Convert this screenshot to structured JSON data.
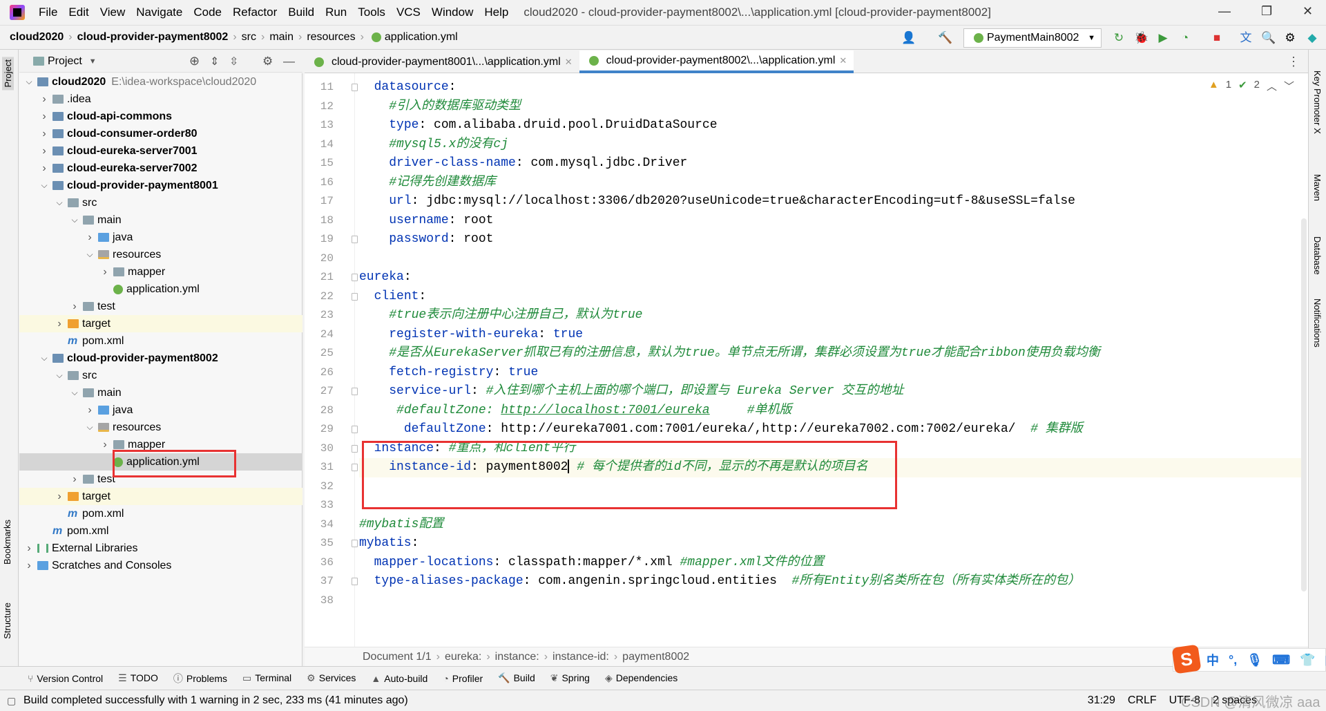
{
  "menubar": {
    "items": [
      "File",
      "Edit",
      "View",
      "Navigate",
      "Code",
      "Refactor",
      "Build",
      "Run",
      "Tools",
      "VCS",
      "Window",
      "Help"
    ],
    "window_title": "cloud2020 - cloud-provider-payment8002\\...\\application.yml [cloud-provider-payment8002]"
  },
  "navbar": {
    "crumbs": [
      "cloud2020",
      "cloud-provider-payment8002",
      "src",
      "main",
      "resources",
      "application.yml"
    ],
    "run_config": "PaymentMain8002"
  },
  "left_strip": {
    "project": "Project",
    "bookmarks": "Bookmarks",
    "structure": "Structure"
  },
  "right_strip": {
    "key_promoter": "Key Promoter X",
    "maven": "Maven",
    "database": "Database",
    "notifications": "Notifications"
  },
  "project_panel": {
    "title": "Project",
    "tree": [
      {
        "label": "cloud2020",
        "extra": "E:\\idea-workspace\\cloud2020",
        "depth": 0,
        "icon": "module",
        "open": true,
        "bold": true
      },
      {
        "label": ".idea",
        "depth": 1,
        "icon": "folder",
        "open": false
      },
      {
        "label": "cloud-api-commons",
        "depth": 1,
        "icon": "module",
        "open": false,
        "bold": true
      },
      {
        "label": "cloud-consumer-order80",
        "depth": 1,
        "icon": "module",
        "open": false,
        "bold": true
      },
      {
        "label": "cloud-eureka-server7001",
        "depth": 1,
        "icon": "module",
        "open": false,
        "bold": true
      },
      {
        "label": "cloud-eureka-server7002",
        "depth": 1,
        "icon": "module",
        "open": false,
        "bold": true
      },
      {
        "label": "cloud-provider-payment8001",
        "depth": 1,
        "icon": "module",
        "open": true,
        "bold": true
      },
      {
        "label": "src",
        "depth": 2,
        "icon": "folder",
        "open": true
      },
      {
        "label": "main",
        "depth": 3,
        "icon": "folder",
        "open": true
      },
      {
        "label": "java",
        "depth": 4,
        "icon": "source",
        "open": false
      },
      {
        "label": "resources",
        "depth": 4,
        "icon": "resources",
        "open": true
      },
      {
        "label": "mapper",
        "depth": 5,
        "icon": "folder",
        "open": false
      },
      {
        "label": "application.yml",
        "depth": 5,
        "icon": "yml",
        "leaf": true
      },
      {
        "label": "test",
        "depth": 3,
        "icon": "folder",
        "open": false
      },
      {
        "label": "target",
        "depth": 2,
        "icon": "target",
        "open": false,
        "highlight": true
      },
      {
        "label": "pom.xml",
        "depth": 2,
        "icon": "pom",
        "leaf": true
      },
      {
        "label": "cloud-provider-payment8002",
        "depth": 1,
        "icon": "module",
        "open": true,
        "bold": true
      },
      {
        "label": "src",
        "depth": 2,
        "icon": "folder",
        "open": true
      },
      {
        "label": "main",
        "depth": 3,
        "icon": "folder",
        "open": true
      },
      {
        "label": "java",
        "depth": 4,
        "icon": "source",
        "open": false
      },
      {
        "label": "resources",
        "depth": 4,
        "icon": "resources",
        "open": true
      },
      {
        "label": "mapper",
        "depth": 5,
        "icon": "folder",
        "open": false
      },
      {
        "label": "application.yml",
        "depth": 5,
        "icon": "yml",
        "leaf": true,
        "selected": true
      },
      {
        "label": "test",
        "depth": 3,
        "icon": "folder",
        "open": false
      },
      {
        "label": "target",
        "depth": 2,
        "icon": "target",
        "open": false,
        "highlight": true
      },
      {
        "label": "pom.xml",
        "depth": 2,
        "icon": "pom",
        "leaf": true
      },
      {
        "label": "pom.xml",
        "depth": 1,
        "icon": "pom",
        "leaf": true
      },
      {
        "label": "External Libraries",
        "depth": 0,
        "icon": "library",
        "open": false
      },
      {
        "label": "Scratches and Consoles",
        "depth": 0,
        "icon": "scratch",
        "open": false
      }
    ]
  },
  "tabs": [
    {
      "label": "cloud-provider-payment8001\\...\\application.yml",
      "active": false
    },
    {
      "label": "cloud-provider-payment8002\\...\\application.yml",
      "active": true
    }
  ],
  "inspections": {
    "warnings": "1",
    "ok": "2"
  },
  "editor": {
    "first_line": 11,
    "current_line": 31,
    "lines": [
      [
        [
          "  ",
          ""
        ],
        [
          "datasource",
          "k"
        ],
        [
          ":",
          "v"
        ]
      ],
      [
        [
          "    ",
          ""
        ],
        [
          "#引入的数据库驱动类型",
          "c"
        ]
      ],
      [
        [
          "    ",
          ""
        ],
        [
          "type",
          "k"
        ],
        [
          ": com.alibaba.druid.pool.DruidDataSource",
          "v"
        ]
      ],
      [
        [
          "    ",
          ""
        ],
        [
          "#mysql5.x的没有cj",
          "c"
        ]
      ],
      [
        [
          "    ",
          ""
        ],
        [
          "driver-class-name",
          "k"
        ],
        [
          ": com.mysql.jdbc.Driver",
          "v"
        ]
      ],
      [
        [
          "    ",
          ""
        ],
        [
          "#记得先创建数据库",
          "c"
        ]
      ],
      [
        [
          "    ",
          ""
        ],
        [
          "url",
          "k"
        ],
        [
          ": jdbc:mysql://localhost:3306/db2020?useUnicode=true&characterEncoding=utf-8&useSSL=false",
          "v"
        ]
      ],
      [
        [
          "    ",
          ""
        ],
        [
          "username",
          "k"
        ],
        [
          ": root",
          "v"
        ]
      ],
      [
        [
          "    ",
          ""
        ],
        [
          "password",
          "k"
        ],
        [
          ": root",
          "v"
        ]
      ],
      [],
      [
        [
          "eureka",
          "k"
        ],
        [
          ":",
          "v"
        ]
      ],
      [
        [
          "  ",
          ""
        ],
        [
          "client",
          "k"
        ],
        [
          ":",
          "v"
        ]
      ],
      [
        [
          "    ",
          ""
        ],
        [
          "#true表示向注册中心注册自己，默认为true",
          "c"
        ]
      ],
      [
        [
          "    ",
          ""
        ],
        [
          "register-with-eureka",
          "k"
        ],
        [
          ": ",
          "v"
        ],
        [
          "true",
          "k"
        ]
      ],
      [
        [
          "    ",
          ""
        ],
        [
          "#是否从EurekaServer抓取已有的注册信息，默认为true。单节点无所谓，集群必须设置为true才能配合ribbon使用负载均衡",
          "c"
        ]
      ],
      [
        [
          "    ",
          ""
        ],
        [
          "fetch-registry",
          "k"
        ],
        [
          ": ",
          "v"
        ],
        [
          "true",
          "k"
        ]
      ],
      [
        [
          "    ",
          ""
        ],
        [
          "service-url",
          "k"
        ],
        [
          ": ",
          "v"
        ],
        [
          "#入住到哪个主机上面的哪个端口，即设置与 Eureka Server 交互的地址",
          "c"
        ]
      ],
      [
        [
          "     ",
          ""
        ],
        [
          "#defaultZone: ",
          "c"
        ],
        [
          "http://localhost:7001/eureka",
          "cu"
        ],
        [
          "     #单机版",
          "c"
        ]
      ],
      [
        [
          "      ",
          ""
        ],
        [
          "defaultZone",
          "k"
        ],
        [
          ": http://eureka7001.com:7001/eureka/,http://eureka7002.com:7002/eureka/  ",
          "v"
        ],
        [
          "# 集群版",
          "c"
        ]
      ],
      [
        [
          "  ",
          ""
        ],
        [
          "instance",
          "k"
        ],
        [
          ": ",
          "v"
        ],
        [
          "#重点，和client平行",
          "c"
        ]
      ],
      [
        [
          "    ",
          ""
        ],
        [
          "instance-id",
          "k"
        ],
        [
          ": payment8002",
          "v"
        ],
        [
          "|caret",
          ""
        ],
        [
          " # 每个提供者的id不同，显示的不再是默认的项目名",
          "c"
        ]
      ],
      [],
      [],
      [
        [
          "#mybatis配置",
          "c"
        ]
      ],
      [
        [
          "mybatis",
          "k"
        ],
        [
          ":",
          "v"
        ]
      ],
      [
        [
          "  ",
          ""
        ],
        [
          "mapper-locations",
          "k"
        ],
        [
          ": classpath:mapper/*.xml ",
          "v"
        ],
        [
          "#mapper.xml文件的位置",
          "c"
        ]
      ],
      [
        [
          "  ",
          ""
        ],
        [
          "type-aliases-package",
          "k"
        ],
        [
          ": com.angenin.springcloud.entities  ",
          "v"
        ],
        [
          "#所有Entity别名类所在包（所有实体类所在的包）",
          "c"
        ]
      ],
      []
    ]
  },
  "editor_breadcrumb": [
    "Document 1/1",
    "eureka:",
    "instance:",
    "instance-id:",
    "payment8002"
  ],
  "tool_windows": [
    {
      "icon": "git-branch-icon",
      "label": "Version Control"
    },
    {
      "icon": "list-icon",
      "label": "TODO"
    },
    {
      "icon": "problems-icon",
      "label": "Problems"
    },
    {
      "icon": "terminal-icon",
      "label": "Terminal"
    },
    {
      "icon": "services-icon",
      "label": "Services"
    },
    {
      "icon": "auto-build-icon",
      "label": "Auto-build"
    },
    {
      "icon": "profiler-icon",
      "label": "Profiler"
    },
    {
      "icon": "hammer-icon",
      "label": "Build"
    },
    {
      "icon": "spring-icon",
      "label": "Spring"
    },
    {
      "icon": "dependencies-icon",
      "label": "Dependencies"
    }
  ],
  "statusbar": {
    "message": "Build completed successfully with 1 warning in 2 sec, 233 ms (41 minutes ago)",
    "position": "31:29",
    "line_sep": "CRLF",
    "encoding": "UTF-8",
    "indent": "2 spaces"
  },
  "ime": {
    "lang": "中",
    "punct": "°,"
  },
  "watermark": "CSDN @清风微凉 aaa",
  "colors": {
    "keyword": "#0033b3",
    "comment": "#1f8a3a",
    "accent": "#4083c9",
    "highlight_box": "#e83232"
  }
}
